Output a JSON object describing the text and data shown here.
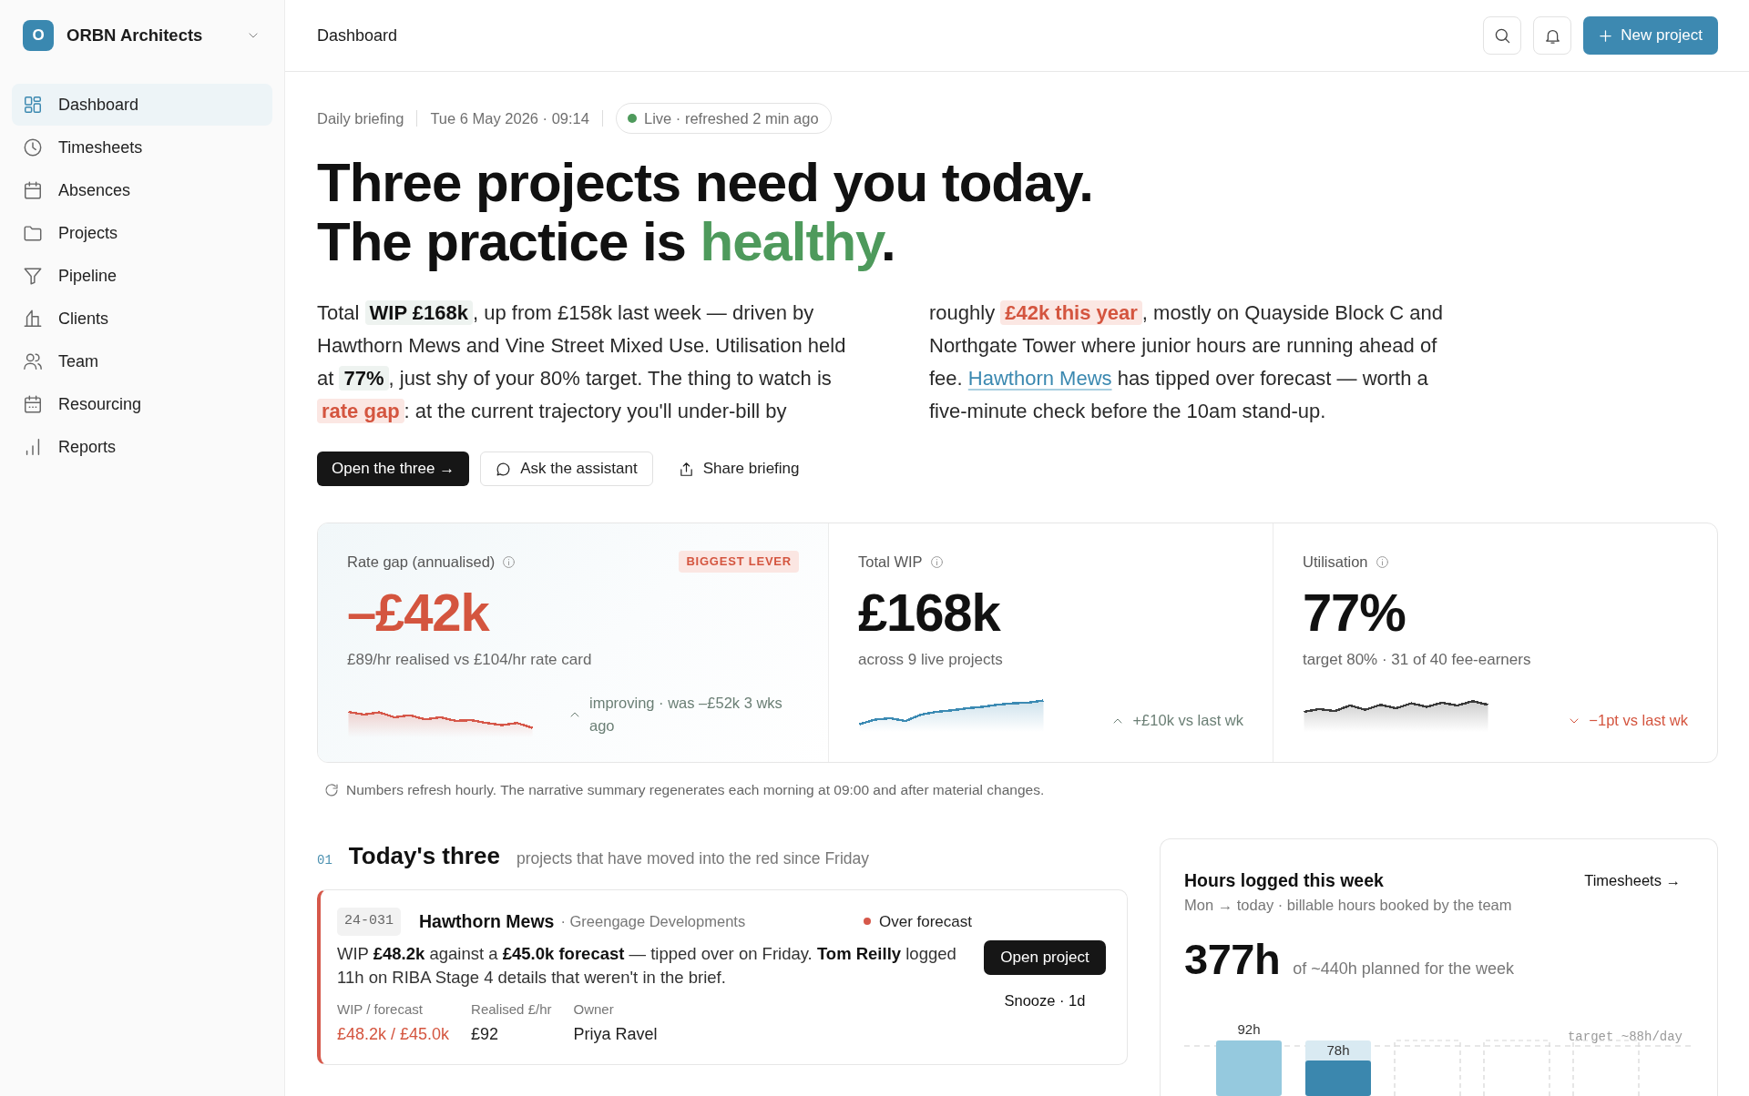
{
  "sidebar": {
    "workspace": {
      "initial": "O",
      "name": "ORBN Architects"
    },
    "items": [
      {
        "label": "Dashboard",
        "selected": true
      },
      {
        "label": "Timesheets",
        "selected": false
      },
      {
        "label": "Absences",
        "selected": false
      },
      {
        "label": "Projects",
        "selected": false
      },
      {
        "label": "Pipeline",
        "selected": false
      },
      {
        "label": "Clients",
        "selected": false
      },
      {
        "label": "Team",
        "selected": false
      },
      {
        "label": "Resourcing",
        "selected": false
      },
      {
        "label": "Reports",
        "selected": false
      }
    ]
  },
  "header": {
    "title": "Dashboard",
    "primary_action": "New project"
  },
  "briefing": {
    "label": "Daily briefing",
    "timestamp": "Tue 6 May 2026 · 09:14",
    "status": {
      "text": "Live · refreshed 2 min ago",
      "live": true
    },
    "headline": [
      [
        {
          "kind": "text",
          "text": "Three projects need you today."
        }
      ],
      [
        {
          "kind": "text",
          "text": "The practice is "
        },
        {
          "kind": "positive",
          "text": "healthy"
        },
        {
          "kind": "text",
          "text": "."
        }
      ]
    ],
    "summary": [
      [
        {
          "kind": "text",
          "text": "Total "
        },
        {
          "kind": "metric",
          "text": "WIP £168k"
        },
        {
          "kind": "text",
          "text": ", up from £158k last week — driven by Hawthorn Mews and Vine Street Mixed Use. Utilisation held at "
        },
        {
          "kind": "metric",
          "text": "77%"
        },
        {
          "kind": "text",
          "text": ", just shy of your 80% target. The thing to watch is "
        },
        {
          "kind": "alert",
          "text": "rate gap"
        },
        {
          "kind": "text",
          "text": ": at the current trajectory you'll under-bill by"
        }
      ],
      [
        {
          "kind": "text",
          "text": "roughly "
        },
        {
          "kind": "alert",
          "text": "£42k this year"
        },
        {
          "kind": "text",
          "text": ", mostly on Quayside Block C and Northgate Tower where junior hours are running ahead of fee. "
        },
        {
          "kind": "link",
          "text": "Hawthorn Mews"
        },
        {
          "kind": "text",
          "text": " has tipped over forecast — worth a five-minute check before the 10am stand-up."
        }
      ]
    ],
    "actions": [
      {
        "kind": "primary",
        "label": "Open the three →"
      },
      {
        "kind": "outline",
        "label": "Ask the assistant"
      },
      {
        "kind": "plain",
        "label": "Share briefing"
      }
    ]
  },
  "kpis": [
    {
      "label": "Rate gap (annualised)",
      "badge": "BIGGEST LEVER",
      "value": "–£42k",
      "alert": true,
      "detail": "£89/hr realised vs £104/hr rate card",
      "color": "#d6584a",
      "trend": {
        "rising": true,
        "text": "improving · was –£52k 3 wks ago"
      }
    },
    {
      "label": "Total WIP",
      "value": "£168k",
      "alert": false,
      "detail": "across 9 live projects",
      "color": "#3b8ab3",
      "trend": {
        "rising": true,
        "text": "+£10k vs last wk"
      }
    },
    {
      "label": "Utilisation",
      "value": "77%",
      "alert": false,
      "detail": "target 80% · 31 of 40 fee-earners",
      "color": "#3a3a3a",
      "trend": {
        "rising": false,
        "text": "−1pt vs last wk"
      }
    }
  ],
  "footnote": "Numbers refresh hourly. The narrative summary regenerates each morning at 09:00 and after material changes.",
  "todays_three": {
    "number": "01",
    "title": "Today's three",
    "subtitle": "projects that have moved into the red since Friday",
    "projects": [
      {
        "code": "24-031",
        "name": "Hawthorn Mews",
        "client": "· Greengage Developments",
        "status": {
          "text": "Over forecast",
          "color": "#d6584a"
        },
        "summary": "WIP **£48.2k** against a **£45.0k forecast** — tipped over on Friday. **Tom Reilly** logged 11h on RIBA Stage 4 details that weren't in the brief.",
        "metrics": [
          {
            "label": "WIP / forecast",
            "value": "£48.2k / £45.0k",
            "alert": true
          },
          {
            "label": "Realised £/hr",
            "value": "£92",
            "alert": false
          },
          {
            "label": "Owner",
            "value": "Priya Ravel",
            "alert": false
          }
        ],
        "primary_action": "Open project",
        "secondary_action": "Snooze · 1d"
      }
    ]
  },
  "hours": {
    "title": "Hours logged this week",
    "link": "Timesheets →",
    "subtitle": "Mon → today · billable hours booked by the team",
    "total": "377h",
    "total_note": "of ~440h planned for the week",
    "target_label": "target ~88h/day",
    "days": [
      {
        "kind": "logged",
        "label": "92h"
      },
      {
        "kind": "today",
        "label": "78h"
      },
      {
        "kind": "upcoming"
      },
      {
        "kind": "upcoming"
      },
      {
        "kind": "upcoming"
      }
    ]
  }
}
